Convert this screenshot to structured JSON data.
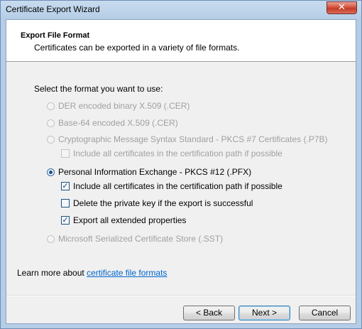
{
  "window": {
    "title": "Certificate Export Wizard",
    "close_glyph": "✕"
  },
  "header": {
    "title": "Export File Format",
    "subtitle": "Certificates can be exported in a variety of file formats."
  },
  "prompt": "Select the format you want to use:",
  "options": [
    {
      "label": "DER encoded binary X.509 (.CER)",
      "selected": false,
      "enabled": false
    },
    {
      "label": "Base-64 encoded X.509 (.CER)",
      "selected": false,
      "enabled": false
    },
    {
      "label": "Cryptographic Message Syntax Standard - PKCS #7 Certificates (.P7B)",
      "selected": false,
      "enabled": false
    },
    {
      "label": "Personal Information Exchange - PKCS #12 (.PFX)",
      "selected": true,
      "enabled": true
    },
    {
      "label": "Microsoft Serialized Certificate Store (.SST)",
      "selected": false,
      "enabled": false
    }
  ],
  "p7b_include": {
    "label": "Include all certificates in the certification path if possible",
    "checked": false,
    "enabled": false
  },
  "pfx_checks": [
    {
      "label": "Include all certificates in the certification path if possible",
      "checked": true
    },
    {
      "label": "Delete the private key if the export is successful",
      "checked": false
    },
    {
      "label": "Export all extended properties",
      "checked": true
    }
  ],
  "learn_more": {
    "prefix": "Learn more about ",
    "link": "certificate file formats"
  },
  "buttons": {
    "back": "< Back",
    "next": "Next >",
    "cancel": "Cancel"
  },
  "check_glyph": "✓"
}
